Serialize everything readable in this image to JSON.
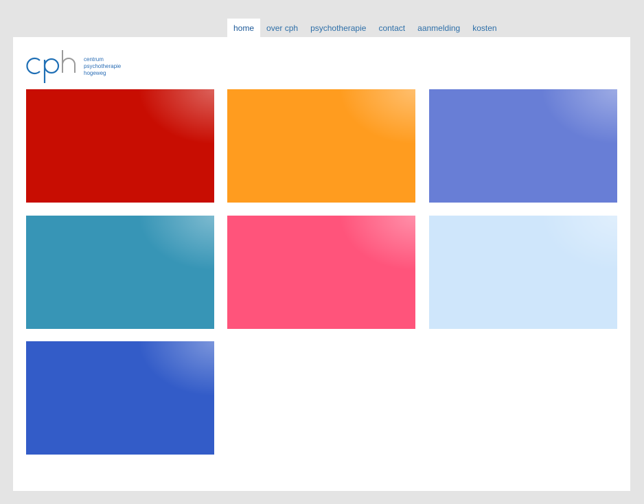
{
  "nav": {
    "items": [
      {
        "label": "home"
      },
      {
        "label": "over cph"
      },
      {
        "label": "psychotherapie"
      },
      {
        "label": "contact"
      },
      {
        "label": "aanmelding"
      },
      {
        "label": "kosten"
      }
    ],
    "active": "home"
  },
  "logo": {
    "letters": "cph",
    "line1": "centrum",
    "line2": "psychotherapie",
    "line3": "hogeweg",
    "colors": {
      "cp": "#1f6fb5",
      "h": "#9a9a9a"
    }
  },
  "tiles": [
    {
      "color": "#c80d02"
    },
    {
      "color": "#ff9c1f"
    },
    {
      "color": "#687ed6"
    },
    {
      "color": "#3795b6"
    },
    {
      "color": "#ff547b"
    },
    {
      "color": "#cfe6fb"
    },
    {
      "color": "#335cc8"
    }
  ]
}
